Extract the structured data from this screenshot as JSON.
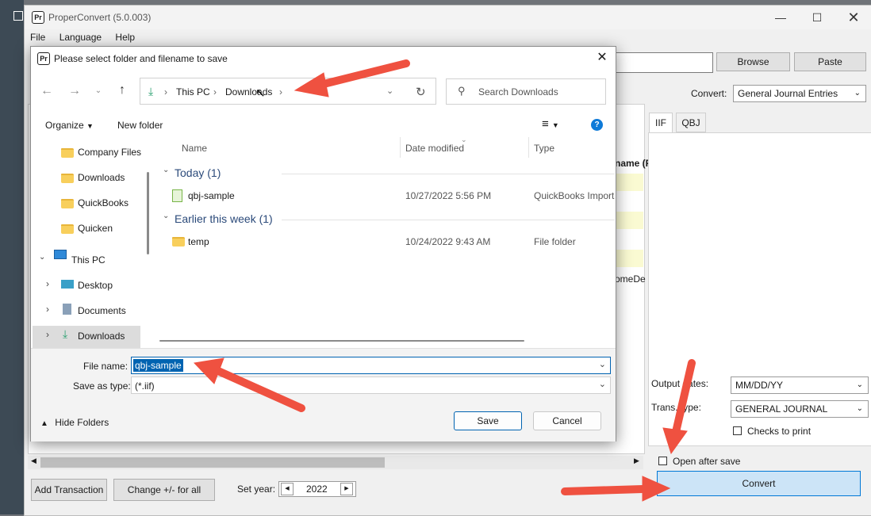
{
  "app": {
    "title": "ProperConvert (5.0.003)",
    "logo": "Pr",
    "menu": [
      "File",
      "Language",
      "Help"
    ],
    "browse_label": "Browse",
    "paste_label": "Paste",
    "convert_label": "Convert:",
    "convert_value": "General Journal Entries",
    "tabs": [
      "IIF",
      "QBJ"
    ],
    "grid_header_partial": "name (F",
    "grid_cell_partial": "omeDe",
    "output_dates_label": "Output dates:",
    "output_dates_value": "MM/DD/YY",
    "trans_type_label": "Trans. type:",
    "trans_type_value": "GENERAL JOURNAL",
    "checks_to_print_label": "Checks to print",
    "open_after_save_label": "Open after save",
    "convert_button": "Convert",
    "add_transaction_label": "Add Transaction",
    "change_sign_label": "Change +/- for all",
    "set_year_label": "Set year:",
    "set_year_value": "2022"
  },
  "dialog": {
    "title": "Please select folder and filename to save",
    "breadcrumb": [
      "This PC",
      "Downloads"
    ],
    "search_placeholder": "Search Downloads",
    "organize_label": "Organize",
    "new_folder_label": "New folder",
    "tree": [
      {
        "label": "Company Files",
        "icon": "folder-icon"
      },
      {
        "label": "Downloads",
        "icon": "folder-icon"
      },
      {
        "label": "QuickBooks",
        "icon": "folder-icon"
      },
      {
        "label": "Quicken",
        "icon": "folder-icon"
      },
      {
        "label": "This PC",
        "icon": "pc-icon"
      },
      {
        "label": "Desktop",
        "icon": "desktop-icon"
      },
      {
        "label": "Documents",
        "icon": "documents-icon"
      },
      {
        "label": "Downloads",
        "icon": "download-icon"
      }
    ],
    "columns": [
      "Name",
      "Date modified",
      "Type"
    ],
    "groups": [
      {
        "label": "Today (1)",
        "files": [
          {
            "name": "qbj-sample",
            "date": "10/27/2022 5:56 PM",
            "type": "QuickBooks Import"
          }
        ]
      },
      {
        "label": "Earlier this week (1)",
        "files": [
          {
            "name": "temp",
            "date": "10/24/2022 9:43 AM",
            "type": "File folder"
          }
        ]
      }
    ],
    "file_name_label": "File name:",
    "file_name_value": "qbj-sample",
    "save_as_type_label": "Save as type:",
    "save_as_type_value": "(*.iif)",
    "hide_folders_label": "Hide Folders",
    "save_label": "Save",
    "cancel_label": "Cancel"
  },
  "colors": {
    "accent": "#0063b1",
    "arrow": "#ef5140",
    "convert_button_bg": "#cce4f7",
    "selected_tree_bg": "#dcdcdc"
  }
}
